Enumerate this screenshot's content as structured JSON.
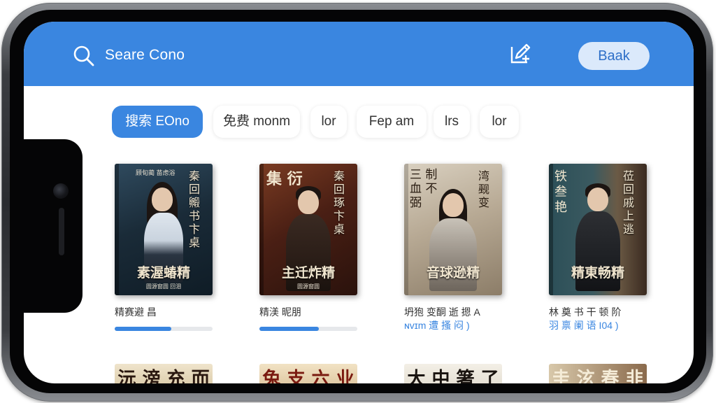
{
  "header": {
    "search_label": "Seare Cono",
    "back_label": "Baak",
    "icons": [
      "search-icon",
      "edit-icon"
    ],
    "bar_color": "#3a86e0"
  },
  "tabs": [
    {
      "label": "搜索 EOno",
      "active": true
    },
    {
      "label": "免费 monm",
      "active": false
    },
    {
      "label": "lor",
      "active": false
    },
    {
      "label": "Fep am",
      "active": false
    },
    {
      "label": "lrs",
      "active": false
    },
    {
      "label": "lor",
      "active": false
    }
  ],
  "books": [
    {
      "cover_title": "素渥蝽精",
      "cover_side": "秦回毈书卞桌",
      "cover_top": "顾旬蔺 苗虑浴",
      "cover_sub": "圆源窗圆 回泪",
      "title": "精赛避 昌",
      "subtitle": "",
      "progress": 0.58
    },
    {
      "cover_title": "主迁炸精",
      "cover_side": "秦回琢卞桌",
      "cover_top": "集 衍",
      "cover_sub": "圆源窗圆",
      "title": "精渼 昵朋",
      "subtitle": "",
      "progress": 0.61
    },
    {
      "cover_title": "音球逊精",
      "cover_side": "湾觋变",
      "cover_top": "三 制 血 不 弼",
      "cover_sub": "",
      "title": "坍狍 变酮 逝 摁 A",
      "subtitle": "ɴvɪm 遭 搔 闷 )",
      "progress": null
    },
    {
      "cover_title": "精東畅精",
      "cover_side": "莅回戚上逃",
      "cover_top": "铁 叁 艳",
      "cover_sub": "",
      "title": "林 奠 书 干 顿 阶",
      "subtitle": "羽 禀 阑 语 I04 )",
      "progress": null
    }
  ],
  "row2_titles": [
    "沅 滂 充 而",
    "兔 支 六 业 的",
    "大 中 箸 了 讲",
    "圭 泫 春 韭 面"
  ]
}
